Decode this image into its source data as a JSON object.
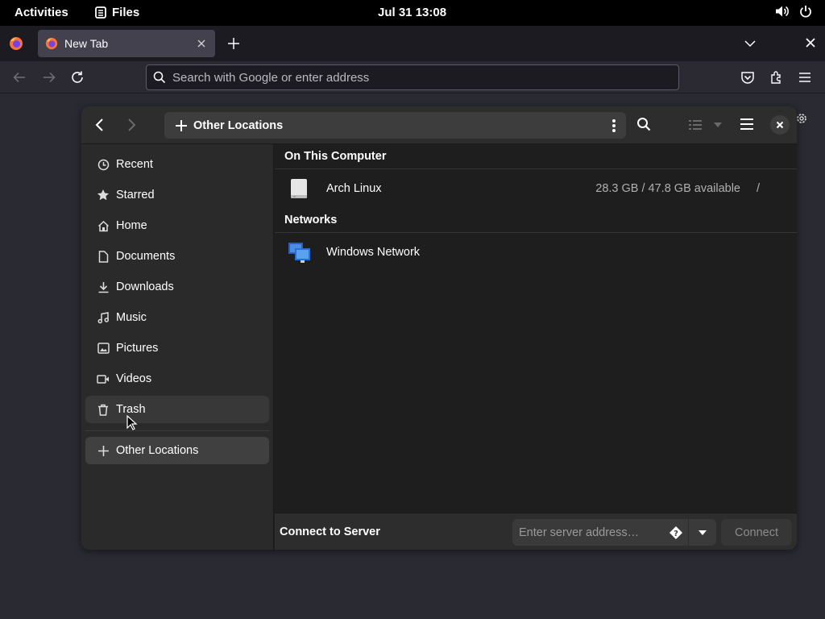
{
  "topbar": {
    "activities": "Activities",
    "app_name": "Files",
    "clock": "Jul 31  13:08"
  },
  "browser": {
    "tab_title": "New Tab",
    "url_placeholder": "Search with Google or enter address"
  },
  "files": {
    "path_label": "Other Locations",
    "sidebar": [
      {
        "label": "Recent",
        "icon": "clock-icon"
      },
      {
        "label": "Starred",
        "icon": "star-icon"
      },
      {
        "label": "Home",
        "icon": "home-icon"
      },
      {
        "label": "Documents",
        "icon": "document-icon"
      },
      {
        "label": "Downloads",
        "icon": "download-icon"
      },
      {
        "label": "Music",
        "icon": "music-icon"
      },
      {
        "label": "Pictures",
        "icon": "picture-icon"
      },
      {
        "label": "Videos",
        "icon": "video-icon"
      },
      {
        "label": "Trash",
        "icon": "trash-icon"
      },
      {
        "label": "Other Locations",
        "icon": "plus-icon"
      }
    ],
    "sections": {
      "on_this_computer": "On This Computer",
      "networks": "Networks"
    },
    "locations": {
      "arch": {
        "name": "Arch Linux",
        "info": "28.3 GB / 47.8 GB available",
        "path": "/"
      },
      "windows": {
        "name": "Windows Network"
      }
    },
    "footer": {
      "label": "Connect to Server",
      "placeholder": "Enter server address…",
      "connect": "Connect"
    }
  },
  "colors": {
    "desktop": "#2a2a33",
    "topbar": "#000000",
    "window_bg": "#1e1e1e",
    "sidebar_bg": "#2a2a2a",
    "headerbar": "#2d2d2d"
  }
}
